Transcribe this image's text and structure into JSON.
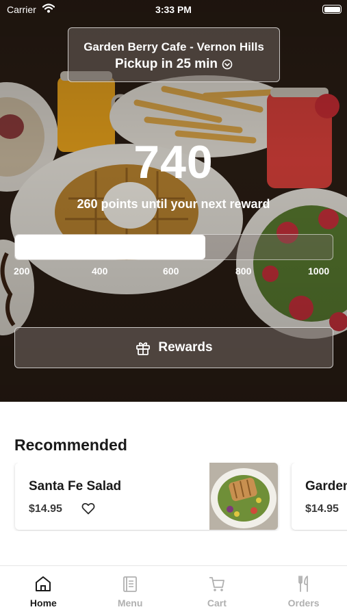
{
  "status_bar": {
    "carrier": "Carrier",
    "time": "3:33 PM"
  },
  "store": {
    "name": "Garden Berry Cafe - Vernon Hills",
    "pickup": "Pickup in 25 min"
  },
  "rewards": {
    "points": "740",
    "subtitle": "260 points until your next reward",
    "progress_fraction": 0.6,
    "ticks": [
      "200",
      "400",
      "600",
      "800",
      "1000"
    ],
    "button_label": "Rewards"
  },
  "recommended": {
    "title": "Recommended",
    "items": [
      {
        "name": "Santa Fe Salad",
        "price": "$14.95"
      },
      {
        "name": "Garden",
        "price": "$14.95"
      }
    ]
  },
  "tabs": [
    {
      "label": "Home",
      "icon": "home-icon",
      "active": true
    },
    {
      "label": "Menu",
      "icon": "menu-icon",
      "active": false
    },
    {
      "label": "Cart",
      "icon": "cart-icon",
      "active": false
    },
    {
      "label": "Orders",
      "icon": "fork-knife-icon",
      "active": false
    }
  ],
  "colors": {
    "accent": "#1a1a1a",
    "inactive_tab": "#b0b0b0",
    "hero_dark": "#22180f"
  }
}
